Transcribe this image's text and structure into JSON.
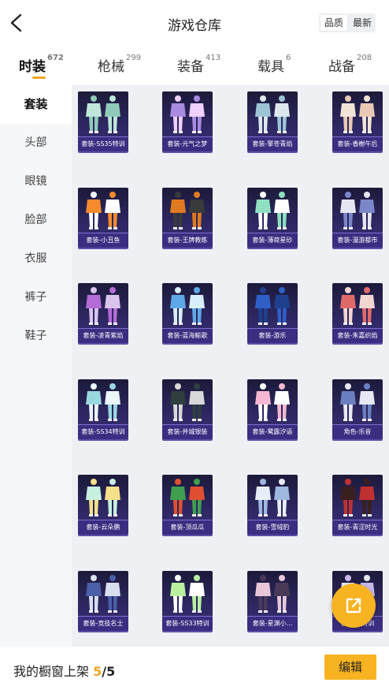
{
  "header": {
    "title": "游戏仓库",
    "sort_options": [
      "品质",
      "最新"
    ],
    "active_sort": "品质"
  },
  "tabs": [
    {
      "label": "时装",
      "count": "672"
    },
    {
      "label": "枪械",
      "count": "299"
    },
    {
      "label": "装备",
      "count": "413"
    },
    {
      "label": "载具",
      "count": "6"
    },
    {
      "label": "战备",
      "count": "208"
    }
  ],
  "sidebar": {
    "items": [
      "套装",
      "头部",
      "眼镜",
      "脸部",
      "衣服",
      "裤子",
      "鞋子"
    ]
  },
  "items": [
    {
      "label": "套装-SS35特训",
      "colors": [
        "#bfe6d9",
        "#8fcab8"
      ]
    },
    {
      "label": "套装-元气之梦",
      "colors": [
        "#a98be0",
        "#f0d0ff"
      ]
    },
    {
      "label": "套装-擎苍青焰",
      "colors": [
        "#9cc4d4",
        "#dce8ee"
      ]
    },
    {
      "label": "套装-香榭午后",
      "colors": [
        "#f2e4d6",
        "#e9c9b5"
      ]
    },
    {
      "label": "套装-小丑鱼",
      "colors": [
        "#f58b2c",
        "#ffffff"
      ]
    },
    {
      "label": "套装-王牌教练",
      "colors": [
        "#e07a1f",
        "#3a3a3a"
      ]
    },
    {
      "label": "套装-薄荷星砂",
      "colors": [
        "#8fe0c0",
        "#ffffff"
      ]
    },
    {
      "label": "套装-漫游都市",
      "colors": [
        "#e6e6f0",
        "#7a86c8"
      ]
    },
    {
      "label": "套装-凌青紫焰",
      "colors": [
        "#b46bd6",
        "#d9c4ec"
      ]
    },
    {
      "label": "套装-蓝海鲸歌",
      "colors": [
        "#5fa8e8",
        "#d8eef8"
      ]
    },
    {
      "label": "套装-游乐",
      "colors": [
        "#2f5fc7",
        "#1f3f8f"
      ]
    },
    {
      "label": "套装-朱嘉织焰",
      "colors": [
        "#e06a6a",
        "#f2d6d0"
      ]
    },
    {
      "label": "套装-SS34特训",
      "colors": [
        "#9ad8e0",
        "#eaf6f8"
      ]
    },
    {
      "label": "套装-并城银装",
      "colors": [
        "#2f3f3f",
        "#d8d8d8"
      ]
    },
    {
      "label": "套装-鹭露汐语",
      "colors": [
        "#f5b8d0",
        "#ffffff"
      ]
    },
    {
      "label": "角色-乐音",
      "colors": [
        "#6a7fbf",
        "#e8e8f4"
      ]
    },
    {
      "label": "套装-云朵鹏",
      "colors": [
        "#c8f0e0",
        "#f5e08a"
      ]
    },
    {
      "label": "套装-顶瓜瓜",
      "colors": [
        "#3f9f4f",
        "#e05030"
      ]
    },
    {
      "label": "套装-雪绒豹",
      "colors": [
        "#e8eef8",
        "#9fb8e0"
      ]
    },
    {
      "label": "套装-青涩时光",
      "colors": [
        "#3a1f1f",
        "#c03030"
      ]
    },
    {
      "label": "套装-竞技名士",
      "colors": [
        "#4a5fa8",
        "#d8e0f0"
      ]
    },
    {
      "label": "套装-SS33特训",
      "colors": [
        "#b8f0a0",
        "#ffffff"
      ]
    },
    {
      "label": "套装-星渊小...",
      "colors": [
        "#e8c8d8",
        "#4a3a5a"
      ]
    },
    {
      "label": "套装-...特训",
      "colors": [
        "#e8e8f0",
        "#c8b8e8"
      ]
    }
  ],
  "footer": {
    "label": "我的橱窗上架",
    "current": "5",
    "separator": "/",
    "total": "5",
    "edit_label": "编辑"
  },
  "colors": {
    "accent": "#f5a623",
    "card_bg": "#2c2760"
  }
}
